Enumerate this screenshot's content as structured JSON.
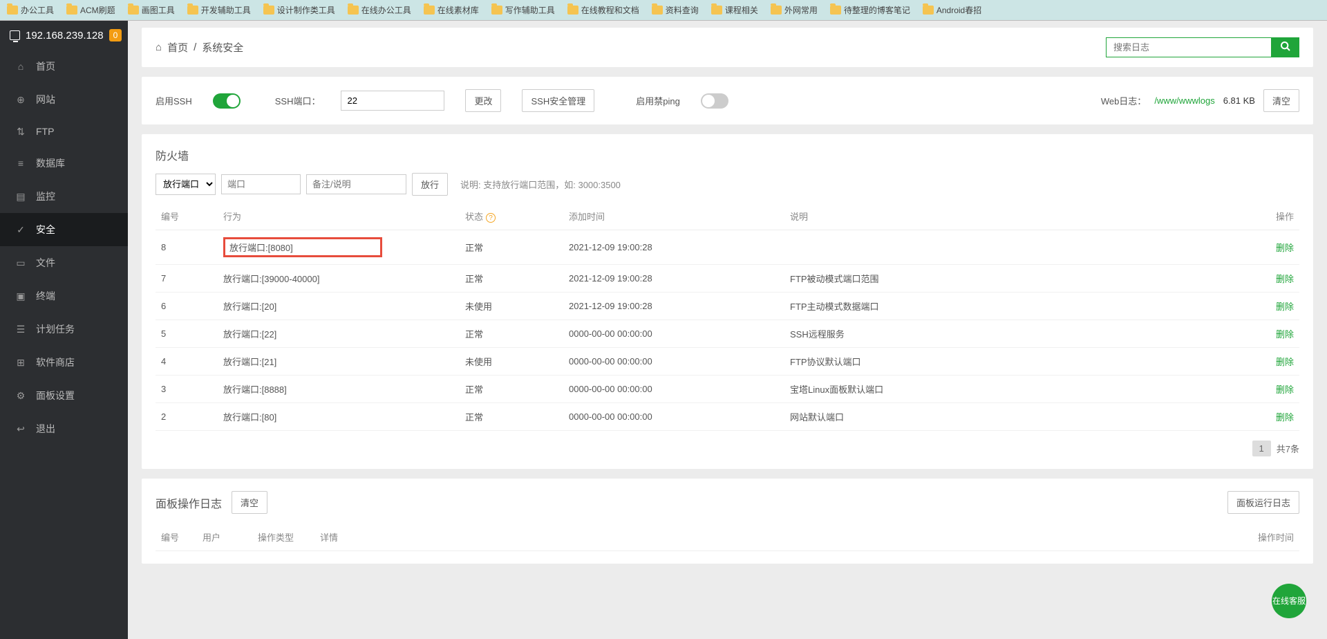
{
  "bookmarks": [
    "办公工具",
    "ACM刷题",
    "画图工具",
    "开发辅助工具",
    "设计制作类工具",
    "在线办公工具",
    "在线素材库",
    "写作辅助工具",
    "在线教程和文档",
    "资料查询",
    "课程相关",
    "外网常用",
    "待整理的博客笔记",
    "Android春招"
  ],
  "server_ip": "192.168.239.128",
  "badge_count": "0",
  "sidebar": [
    {
      "label": "首页",
      "icon": "home"
    },
    {
      "label": "网站",
      "icon": "globe"
    },
    {
      "label": "FTP",
      "icon": "ftp"
    },
    {
      "label": "数据库",
      "icon": "db"
    },
    {
      "label": "监控",
      "icon": "chart"
    },
    {
      "label": "安全",
      "icon": "shield"
    },
    {
      "label": "文件",
      "icon": "folder"
    },
    {
      "label": "终端",
      "icon": "terminal"
    },
    {
      "label": "计划任务",
      "icon": "calendar"
    },
    {
      "label": "软件商店",
      "icon": "grid"
    },
    {
      "label": "面板设置",
      "icon": "gear"
    },
    {
      "label": "退出",
      "icon": "logout"
    }
  ],
  "breadcrumb": {
    "home": "首页",
    "sep": "/",
    "current": "系统安全"
  },
  "search": {
    "placeholder": "搜索日志"
  },
  "ssh": {
    "enable_label": "启用SSH",
    "port_label": "SSH端口：",
    "port_value": "22",
    "change_btn": "更改",
    "mgr_btn": "SSH安全管理",
    "ping_label": "启用禁ping"
  },
  "weblog": {
    "label": "Web日志：",
    "path": "/www/wwwlogs",
    "size": "6.81 KB",
    "clear_btn": "清空"
  },
  "firewall": {
    "title": "防火墙",
    "select_value": "放行端口",
    "port_placeholder": "端口",
    "remark_placeholder": "备注/说明",
    "go_btn": "放行",
    "hint": "说明: 支持放行端口范围，如: 3000:3500",
    "columns": {
      "id": "编号",
      "action": "行为",
      "status": "状态",
      "time": "添加时间",
      "desc": "说明",
      "op": "操作"
    },
    "rows": [
      {
        "id": "8",
        "action": "放行端口:[8080]",
        "status": "正常",
        "time": "2021-12-09 19:00:28",
        "desc": "",
        "hl": true
      },
      {
        "id": "7",
        "action": "放行端口:[39000-40000]",
        "status": "正常",
        "time": "2021-12-09 19:00:28",
        "desc": "FTP被动模式端口范围"
      },
      {
        "id": "6",
        "action": "放行端口:[20]",
        "status": "未使用",
        "time": "2021-12-09 19:00:28",
        "desc": "FTP主动模式数据端口"
      },
      {
        "id": "5",
        "action": "放行端口:[22]",
        "status": "正常",
        "time": "0000-00-00 00:00:00",
        "desc": "SSH远程服务"
      },
      {
        "id": "4",
        "action": "放行端口:[21]",
        "status": "未使用",
        "time": "0000-00-00 00:00:00",
        "desc": "FTP协议默认端口"
      },
      {
        "id": "3",
        "action": "放行端口:[8888]",
        "status": "正常",
        "time": "0000-00-00 00:00:00",
        "desc": "宝塔Linux面板默认端口"
      },
      {
        "id": "2",
        "action": "放行端口:[80]",
        "status": "正常",
        "time": "0000-00-00 00:00:00",
        "desc": "网站默认端口"
      }
    ],
    "delete_label": "删除",
    "pager": {
      "page": "1",
      "total": "共7条"
    }
  },
  "oplog": {
    "title": "面板操作日志",
    "clear_btn": "清空",
    "runlog_btn": "面板运行日志",
    "columns": {
      "id": "编号",
      "user": "用户",
      "type": "操作类型",
      "detail": "详情",
      "time": "操作时间"
    }
  },
  "fab_label": "在线客服"
}
